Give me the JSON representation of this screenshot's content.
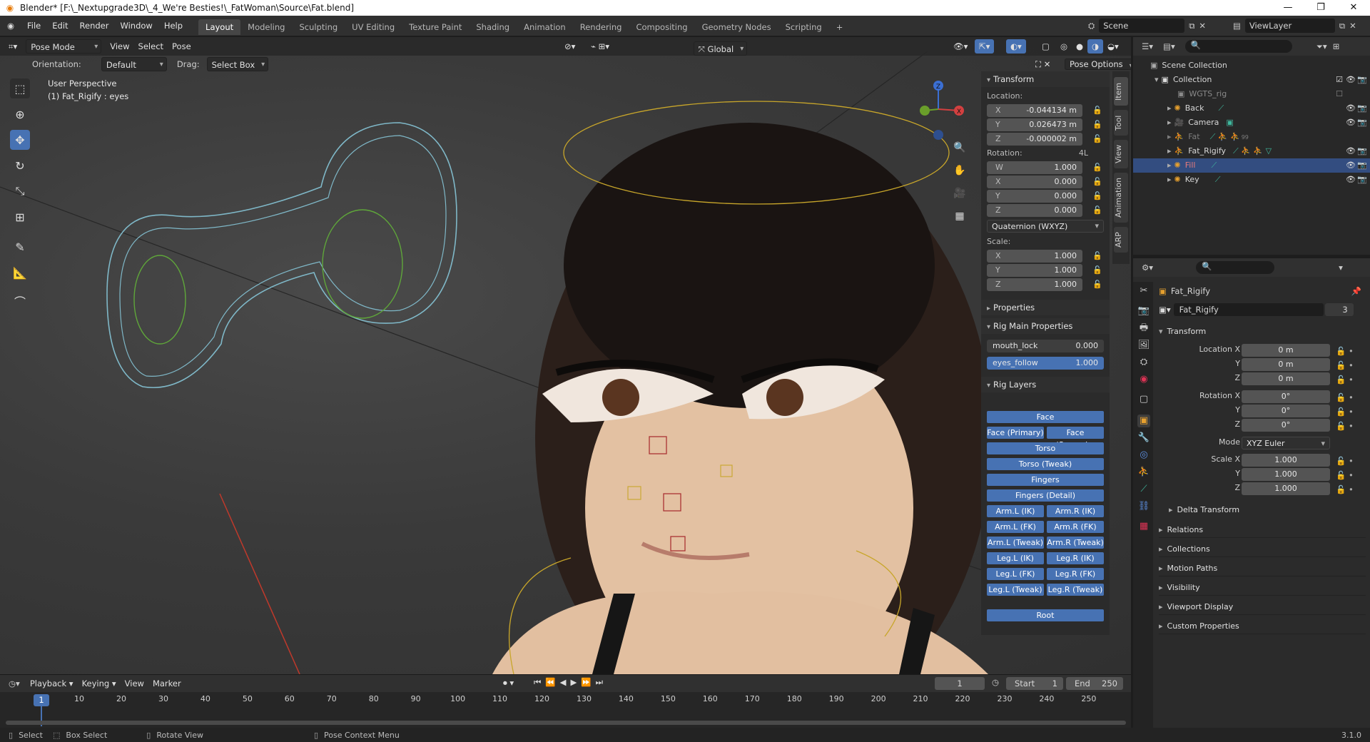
{
  "window": {
    "title": "Blender* [F:\\_Nextupgrade3D\\_4_We're Besties!\\_FatWoman\\Source\\Fat.blend]",
    "minimize": "—",
    "maximize": "❐",
    "close": "✕"
  },
  "menu": [
    "File",
    "Edit",
    "Render",
    "Window",
    "Help"
  ],
  "workspaces": [
    "Layout",
    "Modeling",
    "Sculpting",
    "UV Editing",
    "Texture Paint",
    "Shading",
    "Animation",
    "Rendering",
    "Compositing",
    "Geometry Nodes",
    "Scripting"
  ],
  "workspace_add": "+",
  "scene": {
    "name": "Scene",
    "view_layer": "ViewLayer"
  },
  "viewport": {
    "mode": "Pose Mode",
    "menus": [
      "View",
      "Select",
      "Pose"
    ],
    "transform_orientation": "Global",
    "orientation_label": "Orientation:",
    "orientation_value": "Default",
    "drag_label": "Drag:",
    "drag_value": "Select Box",
    "pose_options": "Pose Options",
    "overlay_text_1": "User Perspective",
    "overlay_text_2": "(1) Fat_Rigify : eyes",
    "gizmo": {
      "z": "Z",
      "x": "X",
      "y": "Y"
    }
  },
  "npanel": {
    "tabs": [
      "Item",
      "Tool",
      "View",
      "Animation",
      "ARP"
    ],
    "transform_header": "Transform",
    "location_label": "Location:",
    "location": [
      {
        "axis": "X",
        "value": "-0.044134 m"
      },
      {
        "axis": "Y",
        "value": "0.026473 m"
      },
      {
        "axis": "Z",
        "value": "-0.000002 m"
      }
    ],
    "rotation_label": "Rotation:",
    "rotation_badge": "4L",
    "rotation": [
      {
        "axis": "W",
        "value": "1.000"
      },
      {
        "axis": "X",
        "value": "0.000"
      },
      {
        "axis": "Y",
        "value": "0.000"
      },
      {
        "axis": "Z",
        "value": "0.000"
      }
    ],
    "rotation_mode": "Quaternion (WXYZ)",
    "scale_label": "Scale:",
    "scale": [
      {
        "axis": "X",
        "value": "1.000"
      },
      {
        "axis": "Y",
        "value": "1.000"
      },
      {
        "axis": "Z",
        "value": "1.000"
      }
    ],
    "properties_header": "Properties",
    "rig_main_header": "Rig Main Properties",
    "mouth_lock": {
      "label": "mouth_lock",
      "value": "0.000"
    },
    "eyes_follow": {
      "label": "eyes_follow",
      "value": "1.000"
    },
    "rig_layers_header": "Rig Layers",
    "rig_layers": {
      "face": "Face",
      "face_primary": "Face (Primary)",
      "face_secondary": "Face (Second...",
      "torso": "Torso",
      "torso_tweak": "Torso (Tweak)",
      "fingers": "Fingers",
      "fingers_detail": "Fingers (Detail)",
      "arm_l_ik": "Arm.L (IK)",
      "arm_r_ik": "Arm.R (IK)",
      "arm_l_fk": "Arm.L (FK)",
      "arm_r_fk": "Arm.R (FK)",
      "arm_l_tweak": "Arm.L (Tweak)",
      "arm_r_tweak": "Arm.R (Tweak)",
      "leg_l_ik": "Leg.L (IK)",
      "leg_r_ik": "Leg.R (IK)",
      "leg_l_fk": "Leg.L (FK)",
      "leg_r_fk": "Leg.R (FK)",
      "leg_l_tweak": "Leg.L (Tweak)",
      "leg_r_tweak": "Leg.R (Tweak)",
      "root": "Root"
    }
  },
  "outliner": {
    "root": "Scene Collection",
    "collection": "Collection",
    "items": [
      {
        "name": "WGTS_rig"
      },
      {
        "name": "Back"
      },
      {
        "name": "Camera"
      },
      {
        "name": "Fat",
        "badge": "99"
      },
      {
        "name": "Fat_Rigify"
      },
      {
        "name": "Fill"
      },
      {
        "name": "Key"
      }
    ]
  },
  "properties": {
    "object_name": "Fat_Rigify",
    "data_name": "Fat_Rigify",
    "users": "3",
    "transform_header": "Transform",
    "location": {
      "x_label": "Location X",
      "y_label": "Y",
      "z_label": "Z",
      "x": "0 m",
      "y": "0 m",
      "z": "0 m"
    },
    "rotation": {
      "x_label": "Rotation X",
      "y_label": "Y",
      "z_label": "Z",
      "x": "0°",
      "y": "0°",
      "z": "0°"
    },
    "mode_label": "Mode",
    "mode_value": "XYZ Euler",
    "scale": {
      "x_label": "Scale X",
      "y_label": "Y",
      "z_label": "Z",
      "x": "1.000",
      "y": "1.000",
      "z": "1.000"
    },
    "sections": [
      "Delta Transform",
      "Relations",
      "Collections",
      "Motion Paths",
      "Visibility",
      "Viewport Display",
      "Custom Properties"
    ]
  },
  "timeline": {
    "menus": [
      "Playback",
      "Keying",
      "View",
      "Marker"
    ],
    "current_frame": "1",
    "start_label": "Start",
    "start": "1",
    "end_label": "End",
    "end": "250",
    "playhead": "1",
    "ticks": [
      "10",
      "20",
      "30",
      "40",
      "50",
      "60",
      "70",
      "80",
      "90",
      "100",
      "110",
      "120",
      "130",
      "140",
      "150",
      "160",
      "170",
      "180",
      "190",
      "200",
      "210",
      "220",
      "230",
      "240",
      "250"
    ]
  },
  "statusbar": {
    "select": "Select",
    "box_select": "Box Select",
    "rotate_view": "Rotate View",
    "pose_context": "Pose Context Menu",
    "version": "3.1.0"
  },
  "colors": {
    "accent": "#4772b3",
    "selected_row": "#334d80",
    "bone_yellow": "#c8a62a",
    "bone_cyan": "#7fb8c8",
    "bone_green": "#5fa63a"
  }
}
